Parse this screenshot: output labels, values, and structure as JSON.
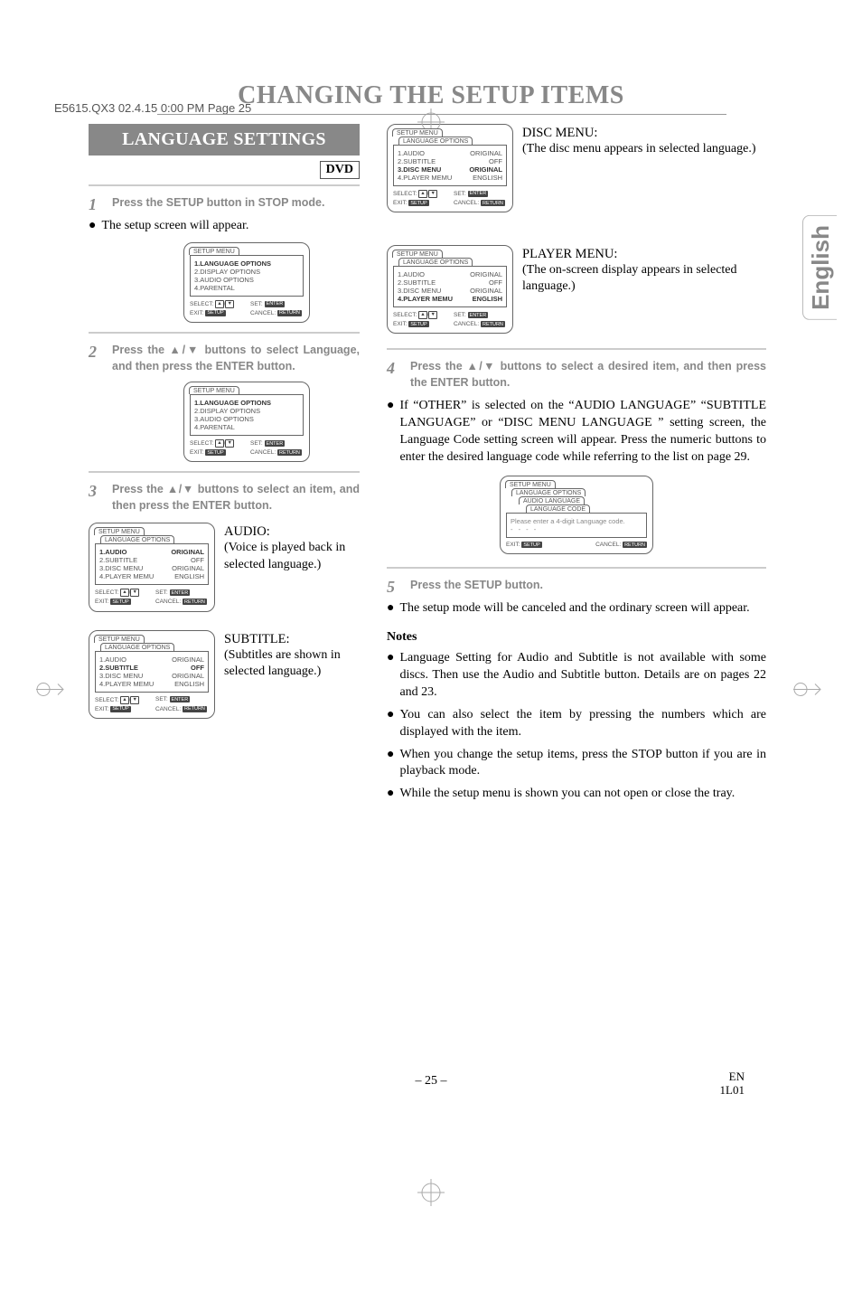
{
  "header": "E5615.QX3  02.4.15 0:00 PM  Page 25",
  "main_title": "CHANGING THE SETUP ITEMS",
  "section_title": "LANGUAGE SETTINGS",
  "badge": "DVD",
  "side_tab": "English",
  "steps": {
    "s1": {
      "num": "1",
      "text": "Press the SETUP button in STOP mode."
    },
    "s1_after": "The setup screen will appear.",
    "s2": {
      "num": "2",
      "text": "Press the ▲/▼ buttons to select Language, and then press the ENTER button."
    },
    "s3": {
      "num": "3",
      "text": "Press the ▲/▼ buttons to select an item, and then press the ENTER button."
    },
    "s4": {
      "num": "4",
      "text": "Press the ▲/▼ buttons to select a desired item, and then press the ENTER button."
    },
    "s4_after": "If “OTHER” is selected on the “AUDIO LANGUAGE” “SUBTITLE LANGUAGE” or “DISC MENU LANGUAGE ” setting screen, the Language Code setting screen will appear. Press the numeric buttons to enter the desired language code while referring to the list on page 29.",
    "s5": {
      "num": "5",
      "text": "Press the SETUP button."
    },
    "s5_after": "The setup mode will be canceled and the ordinary screen will appear."
  },
  "desc": {
    "audio_h": "AUDIO:",
    "audio_t": "(Voice is played back in selected language.)",
    "subtitle_h": "SUBTITLE:",
    "subtitle_t": "(Subtitles are shown in selected language.)",
    "disc_h": "DISC MENU:",
    "disc_t": "(The disc menu appears in selected language.)",
    "player_h": "PLAYER MENU:",
    "player_t": "(The on-screen display appears in selected language.)"
  },
  "menu": {
    "setup_menu": "SETUP MENU",
    "setup_menu_sp": "SETUP  MENU",
    "lang_options": "LANGUAGE OPTIONS",
    "audio_language": "AUDIO LANGUAGE",
    "language_code": "LANGUAGE CODE",
    "code_prompt": "Please enter a 4-digit Language code.",
    "code_dashes": "- - - -",
    "opts": {
      "lang": "1.LANGUAGE OPTIONS",
      "disp": "2.DISPLAY OPTIONS",
      "aud": "3.AUDIO OPTIONS",
      "par": "4.PARENTAL"
    },
    "items": {
      "audio": {
        "l": "1.AUDIO",
        "r": "ORIGINAL"
      },
      "subtitle": {
        "l": "2.SUBTITLE",
        "r": "OFF"
      },
      "disc": {
        "l": "3.DISC MENU",
        "r": "ORIGINAL"
      },
      "player": {
        "l": "4.PLAYER MEMU",
        "r": "ENGLISH"
      }
    },
    "footer": {
      "select": "SELECT:",
      "set": "SET:",
      "exit": "EXIT:",
      "cancel": "CANCEL:",
      "enter": "ENTER",
      "setup": "SETUP",
      "return": "RETURN"
    }
  },
  "notes_h": "Notes",
  "notes": {
    "n1": "Language Setting for Audio and Subtitle is not available with some discs. Then use the Audio and Subtitle button. Details are on pages 22 and 23.",
    "n2": "You can also select the item by pressing the numbers which are displayed with the item.",
    "n3": "When you change the setup items, press the STOP button if you are in playback mode.",
    "n4": "While the setup menu is shown you can not open or close the tray."
  },
  "page_num": "– 25 –",
  "code_label_en": "EN",
  "code_label_code": "1L01"
}
